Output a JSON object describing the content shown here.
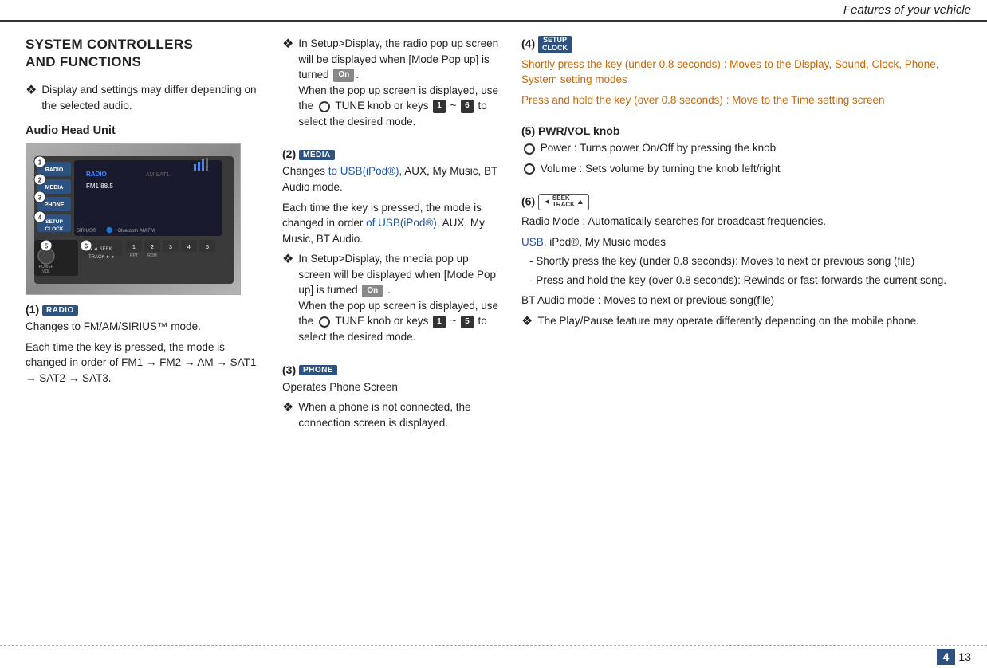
{
  "header": {
    "title": "Features of your vehicle"
  },
  "left_col": {
    "section_title_line1": "SYSTEM CONTROLLERS",
    "section_title_line2": "AND FUNCTIONS",
    "bullet1": "Display and settings may differ depending on the selected audio.",
    "audio_head_unit_label": "Audio Head Unit",
    "item1_label": "(1)",
    "item1_badge": "RADIO",
    "item1_text1": "Changes to FM/AM/SIRIUS™ mode.",
    "item1_text2": "Each time the key is pressed, the mode is changed in order of FM1 → FM2 → AM → SAT1 → SAT2 → SAT3."
  },
  "middle_col": {
    "bullet_setup_display": "In Setup>Display, the radio pop up screen will be displayed when [Mode Pop up] is turned",
    "on_badge": "On",
    "tune_text": "When the pop up screen is displayed, use the",
    "tune_knob": "TUNE knob",
    "tune_keys_text": "or keys",
    "key1": "1",
    "tilde": "~",
    "key6": "6",
    "tune_end": "to select the desired mode.",
    "item2_label": "(2)",
    "item2_badge": "MEDIA",
    "item2_text1": "Changes",
    "item2_text1b": "to USB(iPod®),",
    "item2_text2": "AUX, My Music, BT Audio mode.",
    "item2_text3": "Each time the key is pressed, the mode is changed in order",
    "item2_text3b": "of USB(iPod®),",
    "item2_text4": "AUX, My Music, BT Audio.",
    "bullet_media_setup": "In Setup>Display, the media pop up screen will be displayed when [Mode Pop up] is turned",
    "on_badge2": "On",
    "media_tune_text": "When the pop up screen is displayed, use the",
    "media_tune_knob": "TUNE knob",
    "media_keys_text": "or keys",
    "media_key1": "1",
    "media_tilde": "~",
    "media_key5": "5",
    "media_end": "to select the desired mode.",
    "item3_label": "(3)",
    "item3_badge": "PHONE",
    "item3_text1": "Operates Phone Screen",
    "item3_bullet1": "When a phone is not connected, the connection screen is displayed."
  },
  "right_col": {
    "item4_label": "(4)",
    "item4_badge_top": "SETUP",
    "item4_badge_bottom": "CLOCK",
    "item4_text1": "Shortly press the key (under 0.8 seconds) : Moves to the Display, Sound, Clock, Phone, System setting modes",
    "item4_text2": "Press and hold the key (over 0.8 seconds) : Move to the Time setting screen",
    "item5_label": "(5) PWR/VOL knob",
    "item5_power": "Power : Turns power On/Off by pressing the knob",
    "item5_volume": "Volume : Sets volume by turning the knob left/right",
    "item6_label": "(6)",
    "item6_badge_seek": "SEEK",
    "item6_badge_track": "TRACK",
    "item6_text1": "Radio Mode : Automatically searches for broadcast frequencies.",
    "item6_text2_blue": "USB,",
    "item6_text2_normal": "iPod®, My Music modes",
    "item6_dash1": "Shortly press the key (under 0.8 seconds): Moves to next or previous song (file)",
    "item6_dash2": "Press and hold the key (over 0.8 seconds): Rewinds or fast-forwards the current song.",
    "item6_text3": "BT Audio mode : Moves to next or previous song(file)",
    "item6_bullet": "The Play/Pause feature may operate differently depending on the mobile phone."
  },
  "footer": {
    "page_num_box": "4",
    "page_num": "13"
  }
}
